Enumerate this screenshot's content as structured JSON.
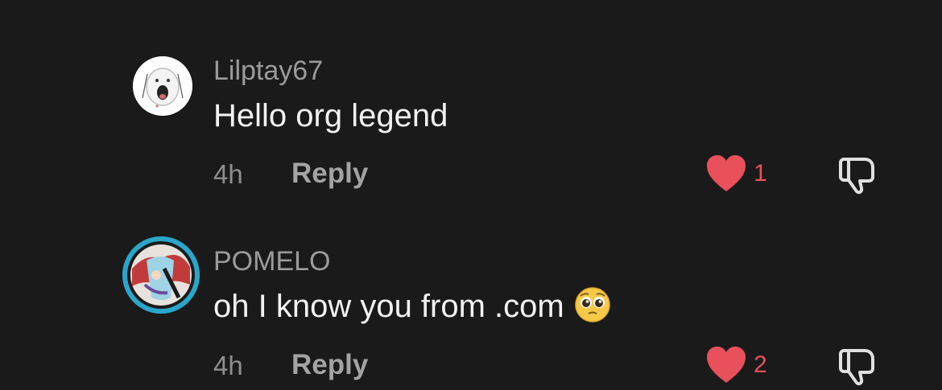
{
  "comments": [
    {
      "username": "Lilptay67",
      "text": "Hello org legend",
      "emoji": "",
      "time": "4h",
      "reply_label": "Reply",
      "like_count": "1",
      "avatar": "cartoon-face-avatar"
    },
    {
      "username": "POMELO",
      "text": "oh I know you from .com",
      "emoji": "pleading-face-emoji",
      "time": "4h",
      "reply_label": "Reply",
      "like_count": "2",
      "avatar": "anime-art-avatar-with-story-ring"
    }
  ],
  "colors": {
    "background": "#1a1a1a",
    "username": "#9b9b9b",
    "text": "#f2f2f2",
    "meta": "#8f8f8f",
    "like_red": "#e8505b",
    "story_ring": "#2aa6c9"
  }
}
